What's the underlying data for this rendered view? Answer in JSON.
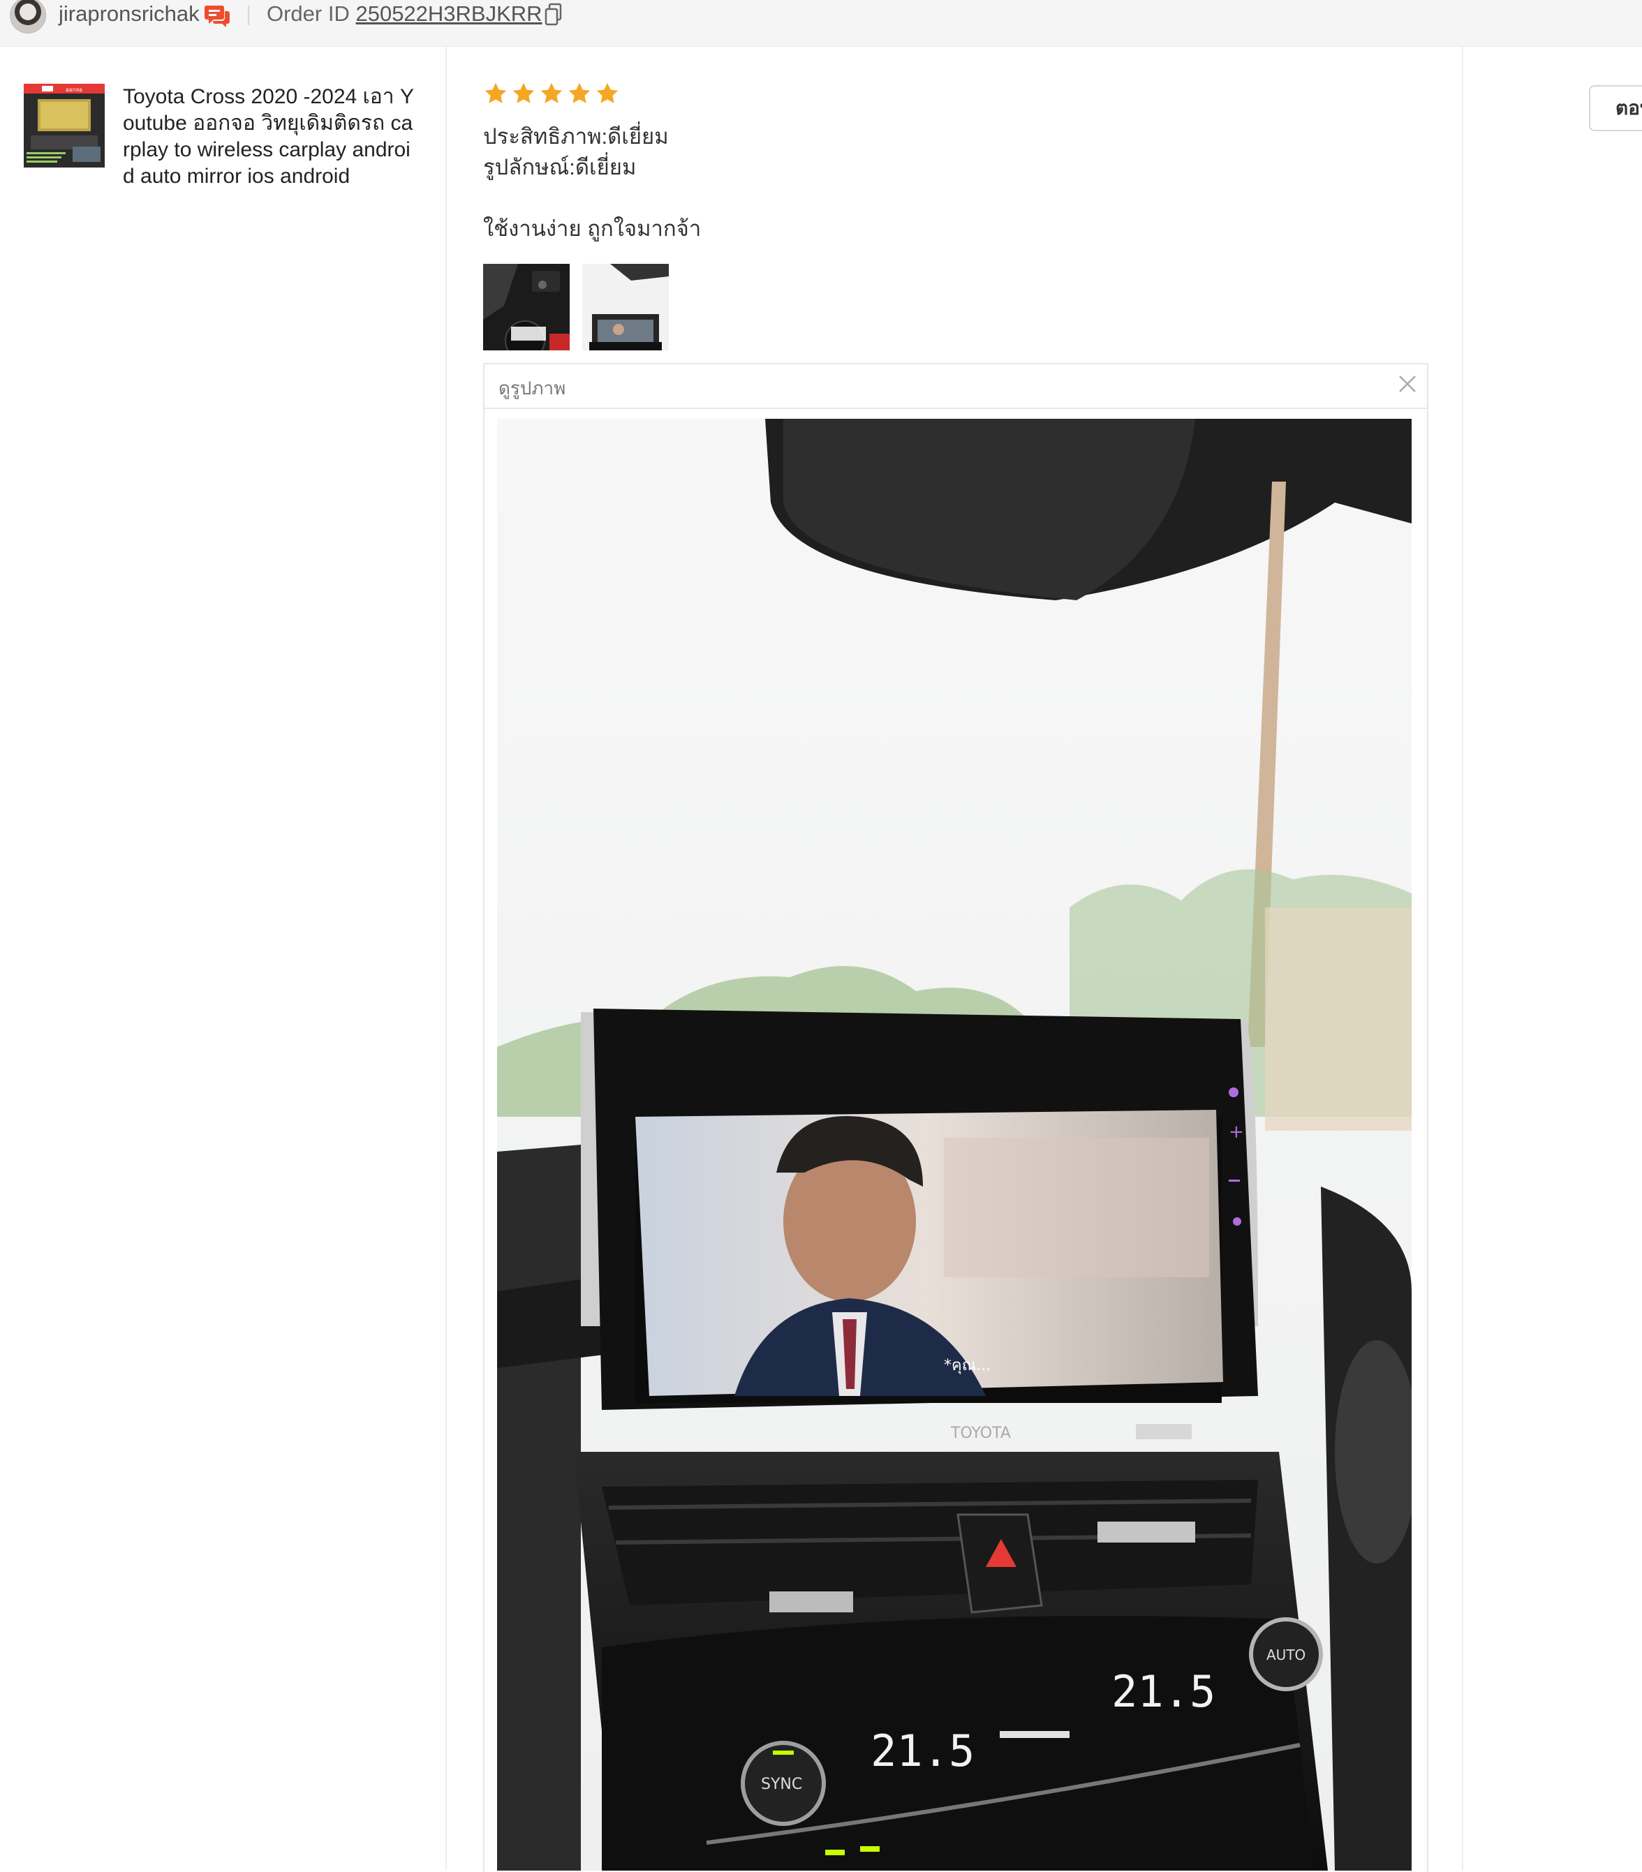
{
  "header": {
    "username": "jirapronsrichak",
    "order_label": "Order ID ",
    "order_id": "250522H3RBJKRR"
  },
  "product": {
    "title": "Toyota Cross 2020 -2024 เอา Youtube ออกจอ วิทยุเดิมติดรถ carplay to wireless carplay android auto mirror ios android",
    "thumb_caption": "ออกจอ"
  },
  "review": {
    "rating": 5,
    "rating_max": 5,
    "lines": [
      "ประสิทธิภาพ:ดีเยี่ยม",
      "รูปลักษณ์:ดีเยี่ยม",
      "ใช้งานง่าย ถูกใจมากจ้า"
    ]
  },
  "viewer": {
    "title": "ดูรูปภาพ",
    "photo_subtitle": "*คุณ...",
    "screen_brand": "TOYOTA",
    "temp_left": "21.5",
    "temp_right": "21.5",
    "button_sync": "SYNC",
    "button_auto": "AUTO"
  },
  "actions": {
    "follow_label": "ตอบ"
  },
  "colors": {
    "star": "#f5a623",
    "chat_icon": "#ee4d2d"
  }
}
